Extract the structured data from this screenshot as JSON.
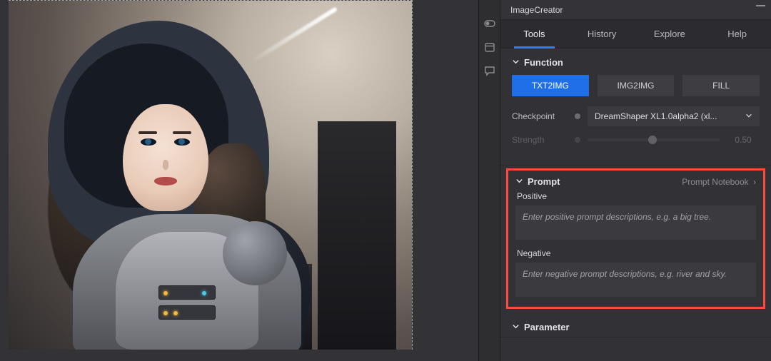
{
  "panel_title": "ImageCreator",
  "tabs": {
    "tools": "Tools",
    "history": "History",
    "explore": "Explore",
    "help": "Help"
  },
  "function": {
    "heading": "Function",
    "modes": {
      "txt2img": "TXT2IMG",
      "img2img": "IMG2IMG",
      "fill": "FILL"
    },
    "checkpoint_label": "Checkpoint",
    "checkpoint_value": "DreamShaper XL1.0alpha2 (xl...",
    "strength_label": "Strength",
    "strength_value": "0.50"
  },
  "prompt": {
    "heading": "Prompt",
    "notebook_link": "Prompt Notebook",
    "positive_label": "Positive",
    "positive_placeholder": "Enter positive prompt descriptions, e.g. a big tree.",
    "negative_label": "Negative",
    "negative_placeholder": "Enter negative prompt descriptions, e.g. river and sky."
  },
  "parameter": {
    "heading": "Parameter"
  },
  "icons": {
    "toggle": "toggle-icon",
    "calendar": "calendar-icon",
    "chat": "chat-icon"
  }
}
